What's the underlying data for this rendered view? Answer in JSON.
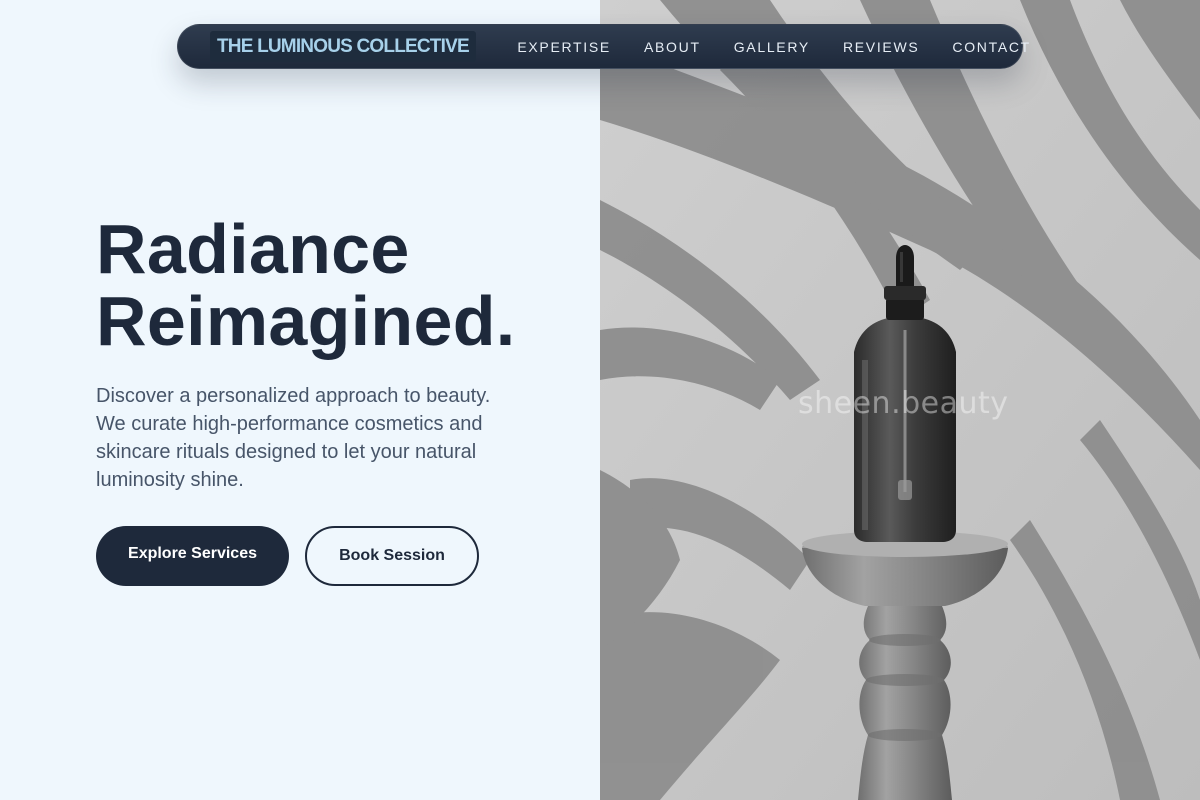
{
  "nav": {
    "brand": "THE LUMINOUS COLLECTIVE",
    "links": [
      "EXPERTISE",
      "ABOUT",
      "GALLERY",
      "REVIEWS",
      "CONTACT"
    ]
  },
  "hero": {
    "title_line1": "Radiance",
    "title_line2": "Reimagined.",
    "description": "Discover a personalized approach to beauty. We curate high-performance cosmetics and skincare rituals designed to let your natural luminosity shine.",
    "primary_cta": "Explore Services",
    "secondary_cta": "Book Session"
  },
  "image": {
    "watermark": "sheen.beauty",
    "subject": "serum dropper bottle on a turned wooden pedestal with leaf shadows"
  },
  "colors": {
    "navy": "#1e293b",
    "background": "#eff7fd",
    "brand_text": "#a7d1ea",
    "body_text": "#475569"
  }
}
